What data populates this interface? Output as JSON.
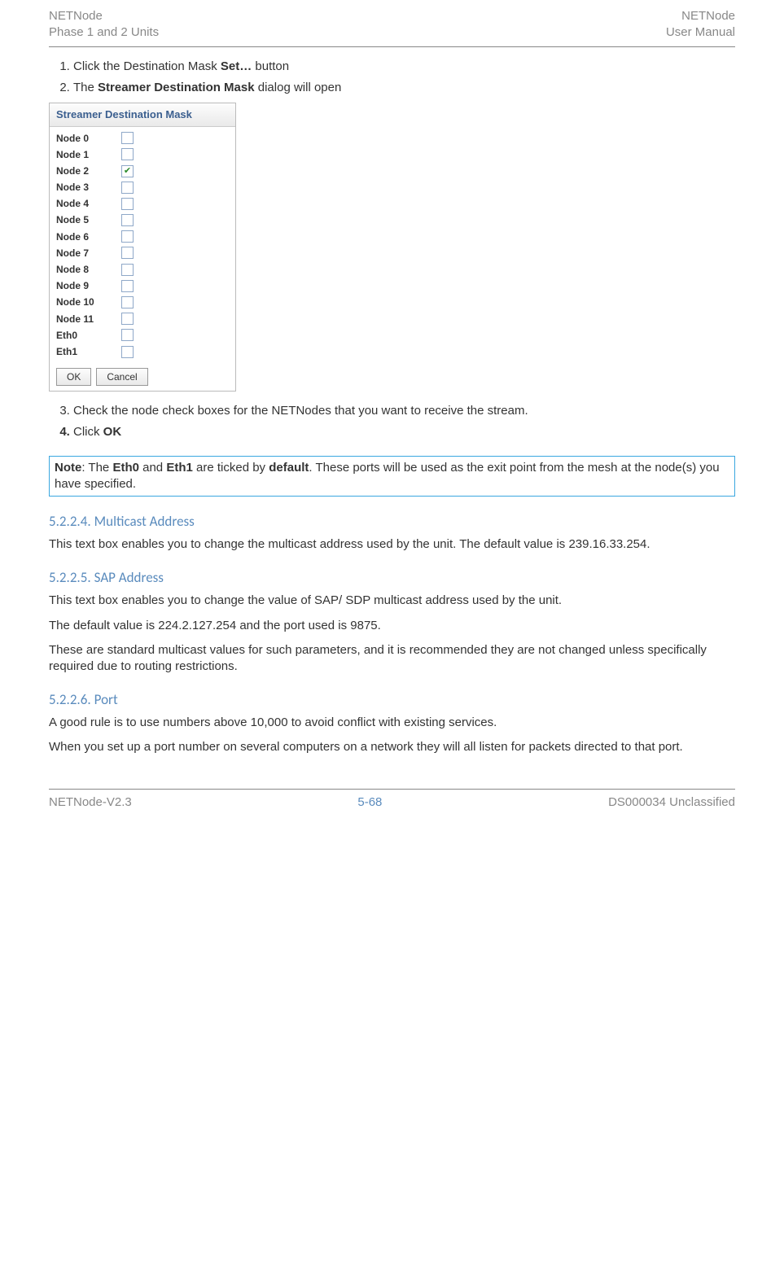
{
  "header": {
    "left_top": "NETNode",
    "left_bottom": "Phase 1 and 2 Units",
    "right_top": "NETNode",
    "right_bottom": "User Manual"
  },
  "steps_a": [
    {
      "pre": "Click the Destination Mask ",
      "bold": "Set…",
      "post": " button"
    },
    {
      "pre": "The ",
      "bold": "Streamer Destination Mask",
      "post": " dialog will open"
    }
  ],
  "dialog": {
    "title": "Streamer Destination Mask",
    "rows": [
      {
        "label": "Node 0",
        "checked": false
      },
      {
        "label": "Node 1",
        "checked": false
      },
      {
        "label": "Node 2",
        "checked": true
      },
      {
        "label": "Node 3",
        "checked": false
      },
      {
        "label": "Node 4",
        "checked": false
      },
      {
        "label": "Node 5",
        "checked": false
      },
      {
        "label": "Node 6",
        "checked": false
      },
      {
        "label": "Node 7",
        "checked": false
      },
      {
        "label": "Node 8",
        "checked": false
      },
      {
        "label": "Node 9",
        "checked": false
      },
      {
        "label": "Node 10",
        "checked": false
      },
      {
        "label": "Node 11",
        "checked": false
      },
      {
        "label": "Eth0",
        "checked": false
      },
      {
        "label": "Eth1",
        "checked": false
      }
    ],
    "ok": "OK",
    "cancel": "Cancel"
  },
  "step3": "Check the node check boxes for the NETNodes that you want to receive the stream.",
  "step4_pre": "Click ",
  "step4_bold": "OK",
  "note": {
    "label": "Note",
    "t1": ": The ",
    "b1": "Eth0",
    "t2": " and ",
    "b2": "Eth1",
    "t3": " are ticked by ",
    "b3": "default",
    "t4": ". These ports will be used as the exit point from the mesh at the node(s) you have specified."
  },
  "s1": {
    "num": "5.2.2.4.",
    "title": "Multicast Address",
    "body": "This text box enables you to change the multicast address used by the unit. The default value is 239.16.33.254."
  },
  "s2": {
    "num": "5.2.2.5.",
    "title": "SAP Address",
    "body1": "This text box enables you to change the value of SAP/ SDP multicast address used by the unit.",
    "body2": "The default value is 224.2.127.254 and the port used is 9875.",
    "body3": "These are standard multicast values for such parameters, and it is recommended they are not changed unless specifically required due to routing restrictions."
  },
  "s3": {
    "num": "5.2.2.6.",
    "title": "Port",
    "body1": "A good rule is to use numbers above 10,000 to avoid conflict with existing services.",
    "body2": "When you set up a port number on several computers on a network they will all listen for packets directed to that port."
  },
  "footer": {
    "left": "NETNode-V2.3",
    "center": "5-68",
    "right": "DS000034 Unclassified"
  }
}
